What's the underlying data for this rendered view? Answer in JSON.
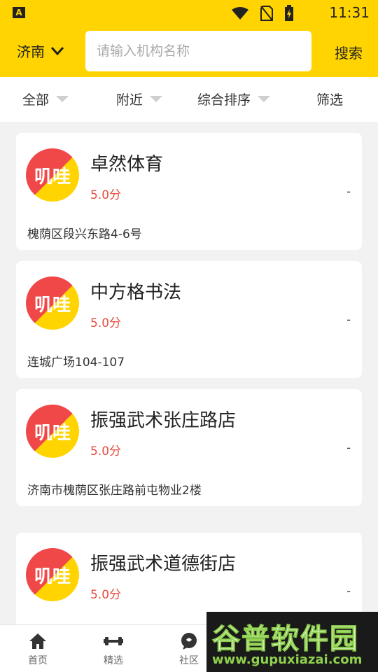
{
  "status_bar": {
    "app_icon": "A",
    "time": "11:31"
  },
  "header": {
    "city": "济南",
    "search_placeholder": "请输入机构名称",
    "search_button": "搜索"
  },
  "filters": [
    "全部",
    "附近",
    "综合排序",
    "筛选"
  ],
  "orgs": [
    {
      "name": "卓然体育",
      "rating": "5.0分",
      "distance": "-",
      "address": "槐荫区段兴东路4-6号",
      "logo_text": "叽哇"
    },
    {
      "name": "中方格书法",
      "rating": "5.0分",
      "distance": "-",
      "address": "连城广场104-107",
      "logo_text": "叽哇"
    },
    {
      "name": "振强武术张庄路店",
      "rating": "5.0分",
      "distance": "-",
      "address": "济南市槐荫区张庄路前屯物业2楼",
      "logo_text": "叽哇"
    },
    {
      "name": "振强武术道德街店",
      "rating": "5.0分",
      "distance": "-",
      "address": "",
      "logo_text": "叽哇"
    }
  ],
  "bottom_nav": [
    {
      "label": "首页",
      "icon": "home-icon"
    },
    {
      "label": "精选",
      "icon": "dumbbell-icon"
    },
    {
      "label": "社区",
      "icon": "chat-icon"
    }
  ],
  "watermark": {
    "title": "谷普软件园",
    "url": "www.gupuxiazai.com"
  },
  "colors": {
    "brand_yellow": "#ffd400",
    "rating_red": "#e74c3c",
    "logo_red": "#f04848"
  }
}
